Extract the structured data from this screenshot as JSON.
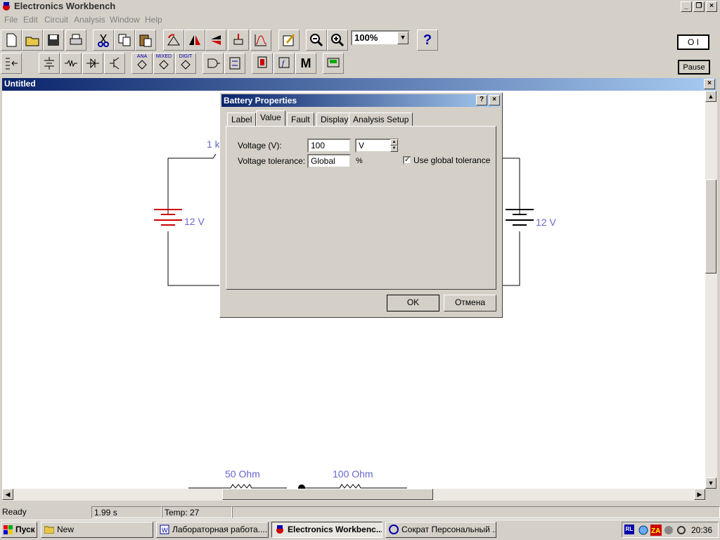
{
  "app": {
    "title": "Electronics Workbench"
  },
  "menu": [
    "File",
    "Edit",
    "Circuit",
    "Analysis",
    "Window",
    "Help"
  ],
  "toolbar": {
    "zoom": "100%",
    "pause_label": "Pause",
    "help_icon": "?",
    "meter_label": "M",
    "power_label": "O I"
  },
  "parts_bin": {
    "ana": "ANA",
    "mixed": "MIXED",
    "digit": "DIGIT"
  },
  "document": {
    "title": "Untitled"
  },
  "circuit": {
    "resistor_top": "1 k",
    "battery_left": "12 V",
    "battery_right": "12 V",
    "resistor_a": "50  Ohm",
    "resistor_b": "100  Ohm"
  },
  "dialog": {
    "title": "Battery Properties",
    "tabs": [
      "Label",
      "Value",
      "Fault",
      "Display",
      "Analysis Setup"
    ],
    "active_tab": "Value",
    "voltage_label": "Voltage (V):",
    "voltage_value": "100",
    "voltage_unit": "V",
    "tolerance_label": "Voltage tolerance:",
    "tolerance_value": "Global",
    "tolerance_unit": "%",
    "global_tol_label": "Use global tolerance",
    "global_tol_checked": true,
    "ok_label": "OK",
    "cancel_label": "Отмена",
    "help_btn": "?",
    "close_btn": "×"
  },
  "status": {
    "ready": "Ready",
    "time": "1.99 s",
    "temp": "Temp:  27"
  },
  "taskbar": {
    "start": "Пуск",
    "tasks": [
      "New",
      "Лабораторная работа....",
      "Electronics Workbenc...",
      "Сократ Персональный ..."
    ],
    "lang": "RL",
    "clock": "20:36"
  }
}
